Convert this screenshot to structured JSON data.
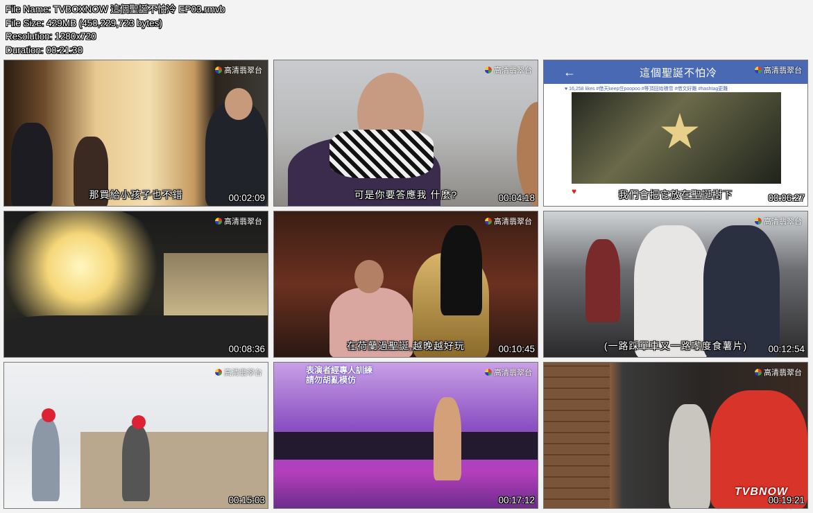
{
  "file_info": [
    "File Name: TVBOXNOW 這個聖誕不怕冷 EP03.rmvb",
    "File Size: 429MB (450,229,723 bytes)",
    "Resolution: 1280x720",
    "Duration: 00:21:30"
  ],
  "channel_logo": "高清翡翠台",
  "thumbnails": [
    {
      "time": "00:02:09",
      "subtitle": "那買給小孩子也不錯"
    },
    {
      "time": "00:04:18",
      "subtitle": "可是你要答應我    什麼?"
    },
    {
      "time": "00:06:27",
      "subtitle": "我們會把它放在聖誕樹下",
      "header": "這個聖誕不怕冷",
      "tags": "♥ 16,258 likes  #借天keep住poopoo #等頂回始積雪 #借文好難 #hashtag更難"
    },
    {
      "time": "00:08:36",
      "subtitle": ""
    },
    {
      "time": "00:10:45",
      "subtitle": "在荷蘭過聖誕,越晚越好玩"
    },
    {
      "time": "00:12:54",
      "subtitle": "(一路踩單車又一路嚟度食薯片)"
    },
    {
      "time": "00:15:03",
      "subtitle": ""
    },
    {
      "time": "00:17:12",
      "subtitle": "",
      "caption": "表演者經專人訓練\n請勿胡亂模仿"
    },
    {
      "time": "00:19:21",
      "subtitle": "",
      "watermark": "TVBNOW"
    }
  ]
}
